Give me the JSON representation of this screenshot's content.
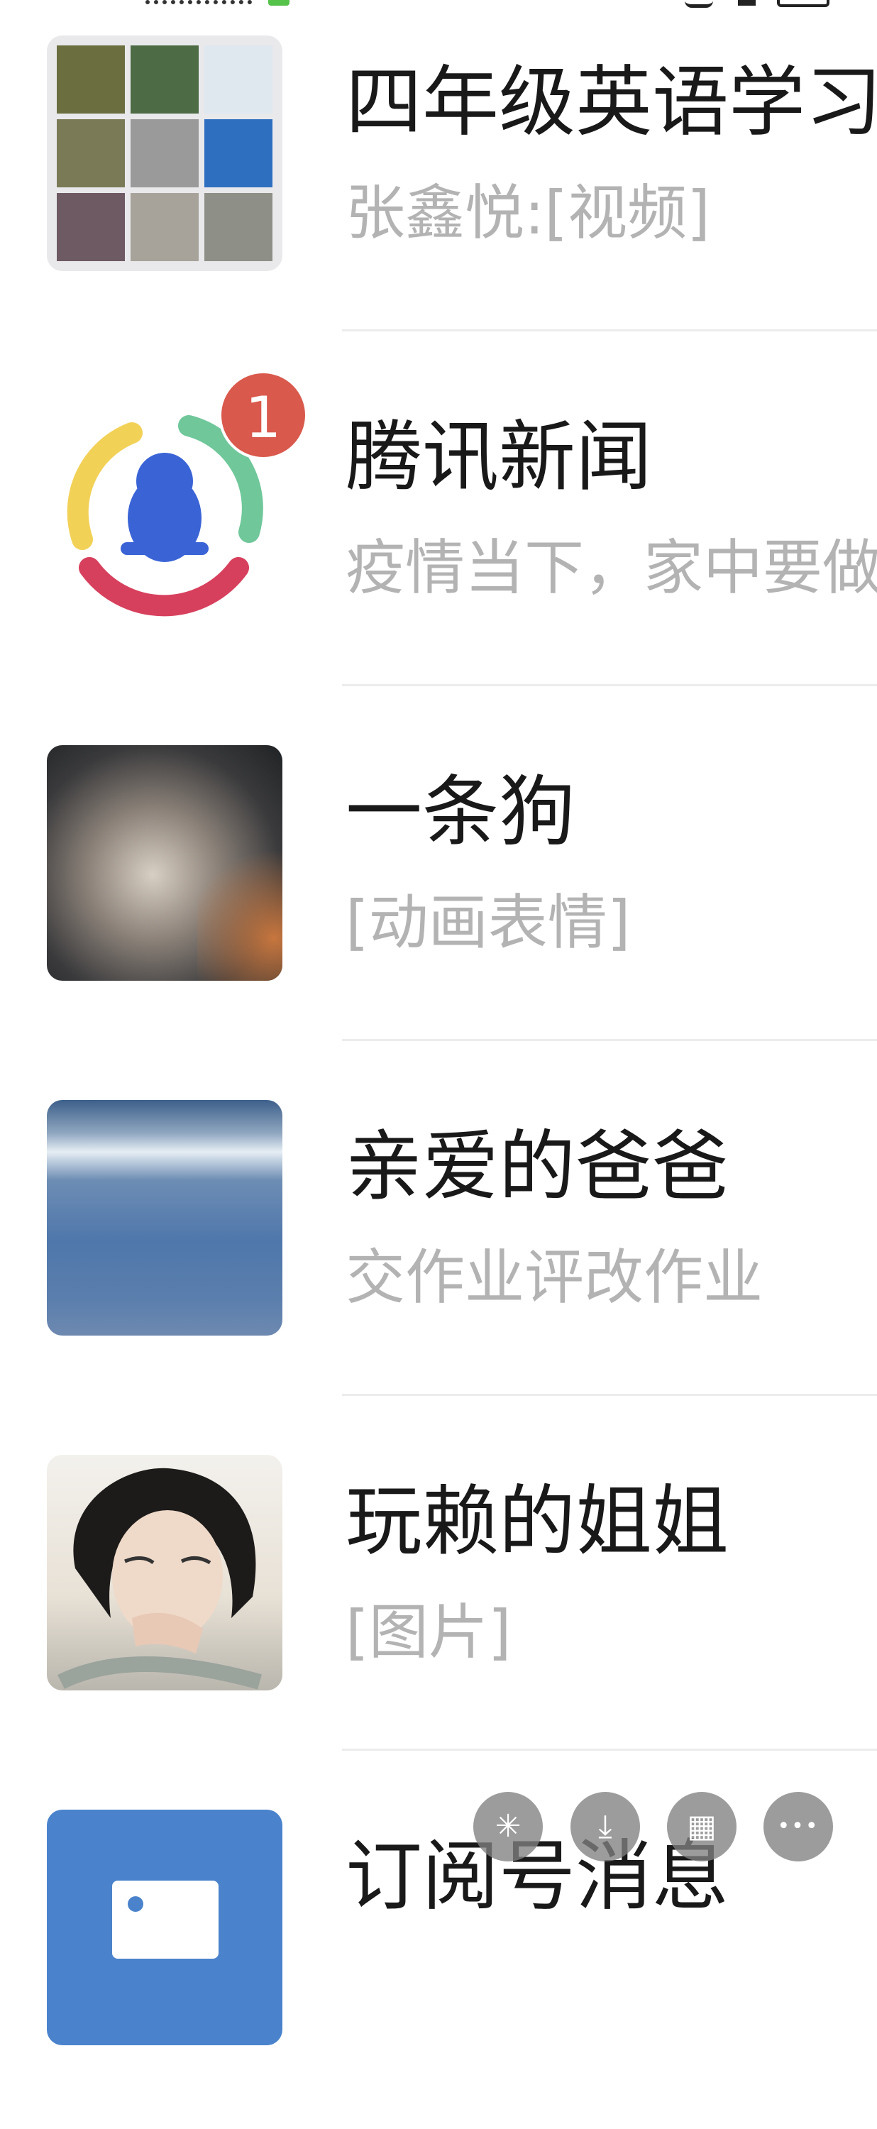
{
  "chats": [
    {
      "title": "四年级英语学习",
      "preview": "张鑫悦:[视频]",
      "avatar": "group-photo-grid"
    },
    {
      "title": "腾讯新闻",
      "preview": "疫情当下，家中要做",
      "avatar": "tencent-news-logo",
      "badge": "1"
    },
    {
      "title": "一条狗",
      "preview": "[动画表情]",
      "avatar": "girl-photo"
    },
    {
      "title": "亲爱的爸爸",
      "preview": "交作业评改作业",
      "avatar": "sky-sea-photo"
    },
    {
      "title": "玩赖的姐姐",
      "preview": "[图片]",
      "avatar": "sketch-portrait"
    },
    {
      "title": "订阅号消息",
      "preview": "",
      "avatar": "subscription-icon"
    }
  ],
  "floating_toolbar": [
    {
      "icon": "sparkle-icon",
      "glyph": "✳"
    },
    {
      "icon": "download-icon",
      "glyph": "⤓"
    },
    {
      "icon": "grid-icon",
      "glyph": "▦"
    },
    {
      "icon": "more-icon",
      "glyph": "•••"
    }
  ],
  "colors": {
    "badge": "#d9594c",
    "title": "#191919",
    "preview": "#b3b3b3",
    "status_green": "#55c24a"
  }
}
